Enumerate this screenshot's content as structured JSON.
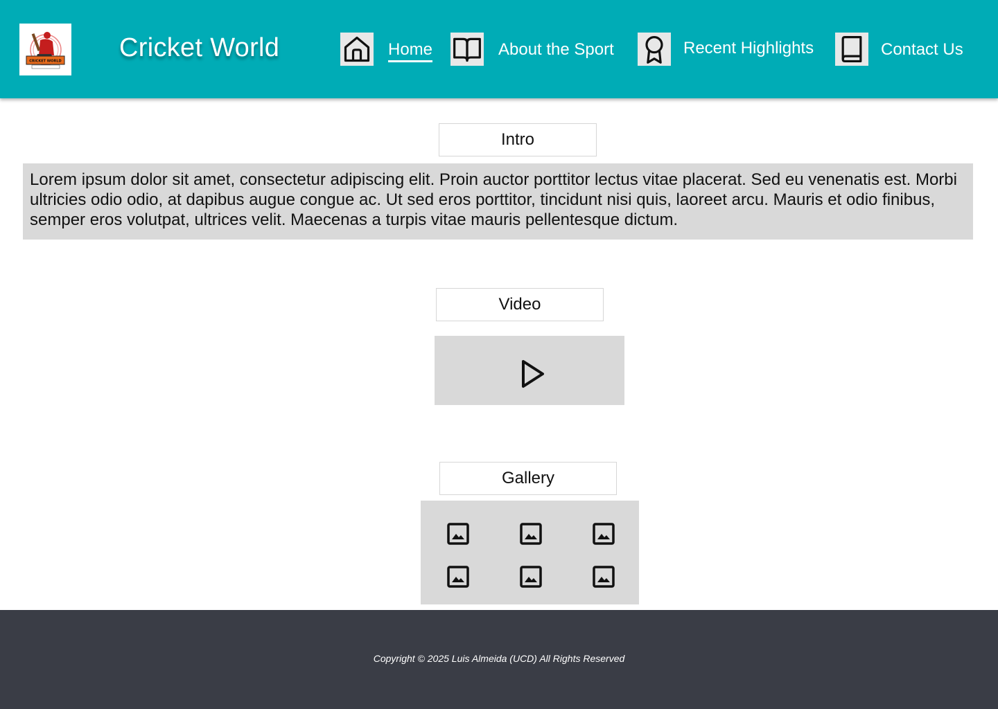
{
  "header": {
    "logo_text": "CRICKET WORLD",
    "site_title": "Cricket World",
    "nav": [
      {
        "icon": "home-icon",
        "label": "Home",
        "active": true
      },
      {
        "icon": "open-book-icon",
        "label": "About the Sport",
        "active": false
      },
      {
        "icon": "award-ribbon-icon",
        "label": "Recent Highlights",
        "active": false
      },
      {
        "icon": "book-icon",
        "label": "Contact Us",
        "active": false
      }
    ]
  },
  "intro": {
    "heading": "Intro",
    "text": "Lorem ipsum dolor sit amet, consectetur adipiscing elit. Proin auctor porttitor lectus vitae placerat. Sed eu venenatis est. Morbi ultricies odio odio, at dapibus augue congue ac. Ut sed eros porttitor, tincidunt nisi quis, laoreet arcu. Mauris et odio finibus, semper eros volutpat, ultrices velit. Maecenas a turpis vitae mauris pellentesque dictum."
  },
  "video": {
    "heading": "Video",
    "icon": "play-icon"
  },
  "gallery": {
    "heading": "Gallery",
    "thumbnail_icon": "image-icon",
    "thumbnail_count": 6
  },
  "footer": {
    "copyright": "Copyright © 2025 Luis Almeida (UCD) All Rights Reserved"
  },
  "colors": {
    "header_bg": "#00acb6",
    "footer_bg": "#3a3d46",
    "panel_bg": "#d9d9d9"
  }
}
